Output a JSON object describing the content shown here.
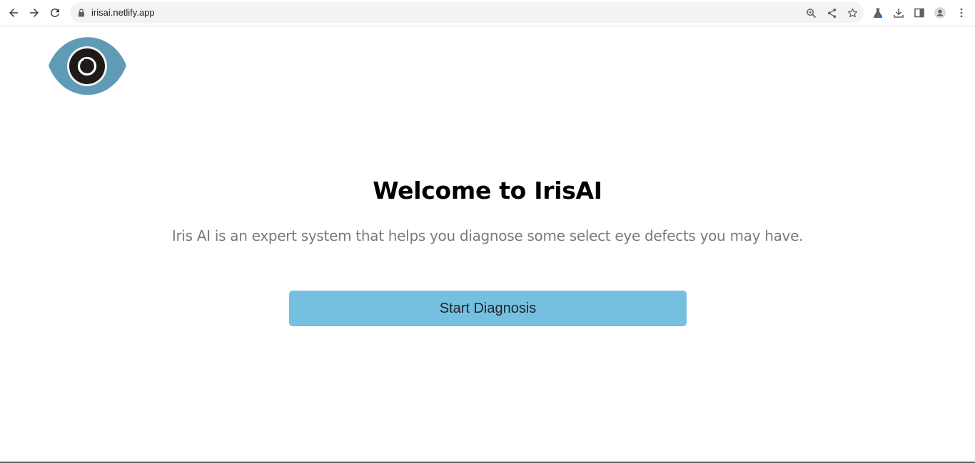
{
  "browser": {
    "url": "irisai.netlify.app",
    "icons": {
      "back": "arrow-left-icon",
      "forward": "arrow-right-icon",
      "reload": "reload-icon",
      "lock": "lock-icon",
      "zoom": "zoom-icon",
      "share": "share-icon",
      "bookmark": "star-icon",
      "labs": "flask-icon",
      "download": "download-icon",
      "side_panel": "side-panel-icon",
      "profile": "profile-icon",
      "menu": "kebab-menu-icon"
    }
  },
  "page": {
    "logo": "eye-logo",
    "title": "Welcome to IrisAI",
    "subtitle": "Iris AI is an expert system that helps you diagnose some select eye defects you may have.",
    "start_button_label": "Start Diagnosis"
  },
  "colors": {
    "button_bg": "#75c0e1",
    "subtitle_text": "#7a7a7a",
    "logo_blue": "#5f9bb5",
    "logo_iris": "#1f1a1a"
  }
}
